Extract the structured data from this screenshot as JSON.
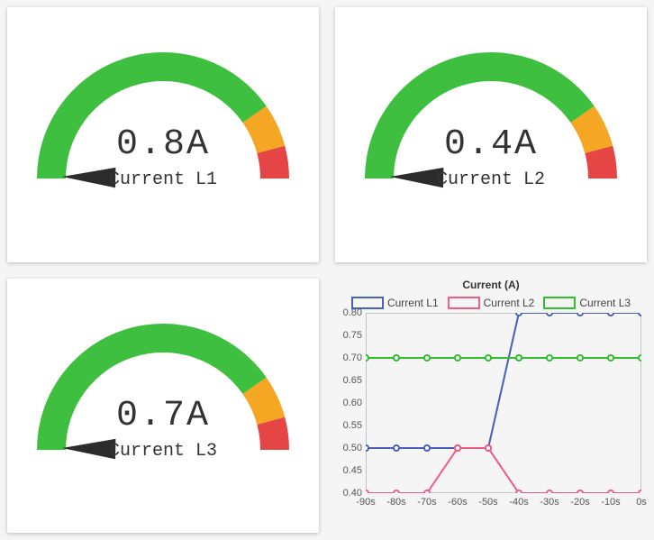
{
  "gauges": [
    {
      "value_text": "0.8A",
      "label": "Current L1",
      "value": 0.8
    },
    {
      "value_text": "0.4A",
      "label": "Current L2",
      "value": 0.4
    },
    {
      "value_text": "0.7A",
      "label": "Current L3",
      "value": 0.7
    }
  ],
  "gauge_style": {
    "green": "#3fbf3f",
    "orange": "#f5a623",
    "red": "#e64545",
    "needle": "#2b2b2b"
  },
  "chart_data": {
    "type": "line",
    "title": "Current (A)",
    "xlabel": "",
    "ylabel": "",
    "x": [
      -90,
      -80,
      -70,
      -60,
      -50,
      -40,
      -30,
      -20,
      -10,
      0
    ],
    "x_ticks": [
      "-90s",
      "-80s",
      "-70s",
      "-60s",
      "-50s",
      "-40s",
      "-30s",
      "-20s",
      "-10s",
      "0s"
    ],
    "ylim": [
      0.4,
      0.8
    ],
    "y_ticks": [
      0.4,
      0.45,
      0.5,
      0.55,
      0.6,
      0.65,
      0.7,
      0.75,
      0.8
    ],
    "series": [
      {
        "name": "Current L1",
        "color": "#4a5fbf",
        "values": [
          0.5,
          0.5,
          0.5,
          0.5,
          0.5,
          0.8,
          0.8,
          0.8,
          0.8,
          0.8
        ]
      },
      {
        "name": "Current L2",
        "color": "#ef5d87",
        "values": [
          0.4,
          0.4,
          0.4,
          0.5,
          0.5,
          0.4,
          0.4,
          0.4,
          0.4,
          0.4
        ]
      },
      {
        "name": "Current L3",
        "color": "#2fbf2f",
        "values": [
          0.7,
          0.7,
          0.7,
          0.7,
          0.7,
          0.7,
          0.7,
          0.7,
          0.7,
          0.7
        ]
      }
    ]
  }
}
